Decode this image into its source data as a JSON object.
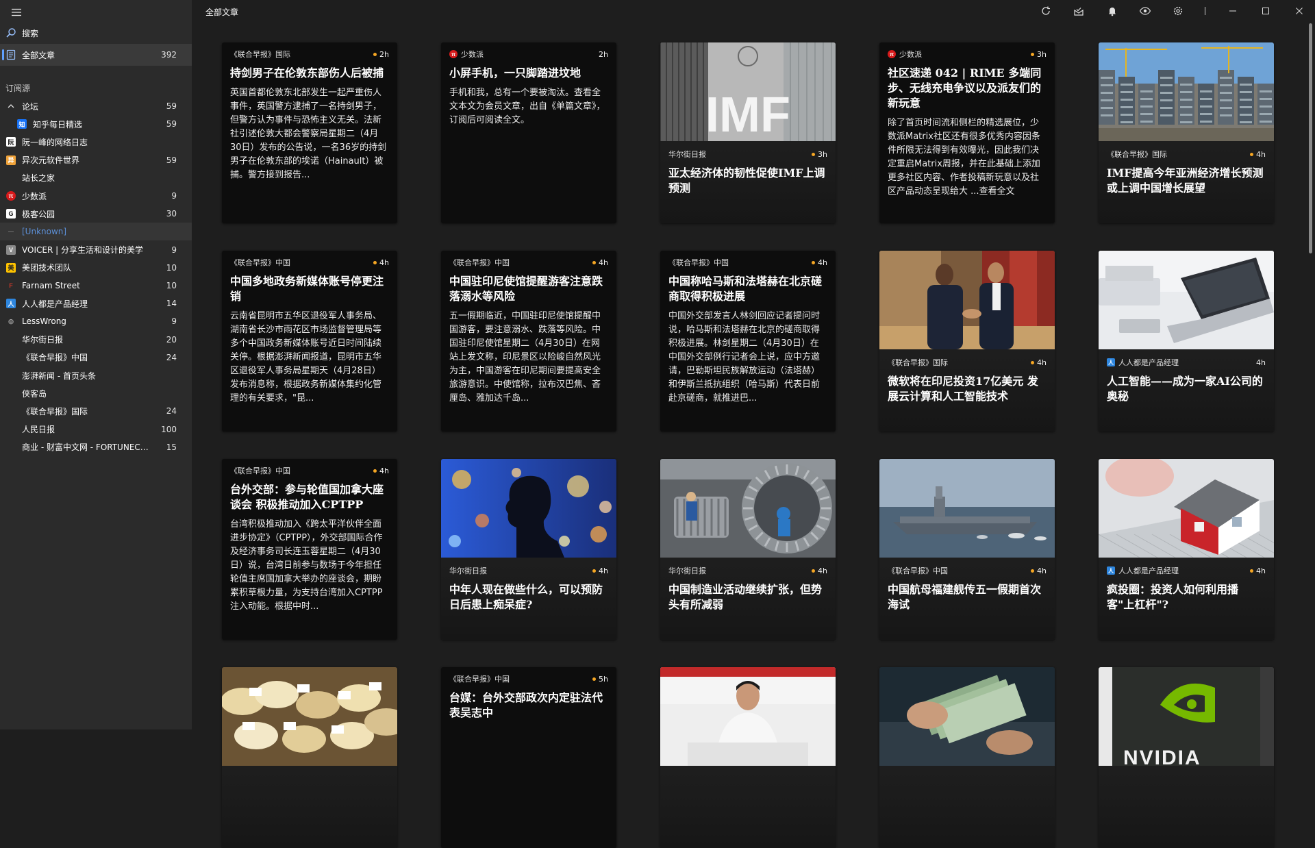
{
  "app": {
    "page_title": "全部文章"
  },
  "sidebar": {
    "search_label": "搜索",
    "all_articles": {
      "label": "全部文章",
      "count": "392"
    },
    "subscriptions_header": "订阅源",
    "items": [
      {
        "label": "论坛",
        "count": "59",
        "icon": "chevron-up-icon",
        "group": true
      },
      {
        "label": "知乎每日精选",
        "count": "59",
        "icon": "zhihu-icon",
        "indent": true
      },
      {
        "label": "阮一峰的网络日志",
        "count": "",
        "icon": "ruanyifeng-icon"
      },
      {
        "label": "异次元软件世界",
        "count": "59",
        "icon": "iplaysoft-icon"
      },
      {
        "label": "站长之家",
        "count": "",
        "icon": ""
      },
      {
        "label": "少数派",
        "count": "9",
        "icon": "sspai-icon"
      },
      {
        "label": "极客公园",
        "count": "30",
        "icon": "geekpark-icon"
      },
      {
        "label": "[Unknown]",
        "count": "",
        "icon": "unknown-icon",
        "unknown": true
      },
      {
        "label": "VOICER | 分享生活和设计的美学",
        "count": "9",
        "icon": "voicer-icon"
      },
      {
        "label": "美团技术团队",
        "count": "10",
        "icon": "meituan-icon"
      },
      {
        "label": "Farnam Street",
        "count": "10",
        "icon": "farnam-icon"
      },
      {
        "label": "人人都是产品经理",
        "count": "14",
        "icon": "woshipm-icon"
      },
      {
        "label": "LessWrong",
        "count": "9",
        "icon": "lesswrong-icon"
      },
      {
        "label": "华尔街日报",
        "count": "20",
        "icon": ""
      },
      {
        "label": "《联合早报》中国",
        "count": "24",
        "icon": ""
      },
      {
        "label": "澎湃新闻 - 首页头条",
        "count": "",
        "icon": ""
      },
      {
        "label": "侠客岛",
        "count": "",
        "icon": ""
      },
      {
        "label": "《联合早报》国际",
        "count": "24",
        "icon": ""
      },
      {
        "label": "人民日报",
        "count": "100",
        "icon": ""
      },
      {
        "label": "商业 - 财富中文网 - FORTUNEChina.c...",
        "count": "15",
        "icon": ""
      }
    ]
  },
  "titlebar": {
    "icons": [
      "refresh-icon",
      "mark-all-read-icon",
      "notification-icon",
      "view-mode-icon",
      "settings-icon"
    ],
    "window_controls": [
      "minimize-icon",
      "maximize-icon",
      "close-icon"
    ]
  },
  "articles": [
    {
      "source": "《联合早报》国际",
      "time": "2h",
      "unread": true,
      "image": "",
      "title": "持剑男子在伦敦东部伤人后被捕",
      "snippet": "英国首都伦敦东北部发生一起严重伤人事件，英国警方逮捕了一名持剑男子，但警方认为事件与恐怖主义无关。法新社引述伦敦大都会警察局星期二（4月30日）发布的公告说，一名36岁的持剑男子在伦敦东部的埃诺（Hainault）被捕。警方接到报告..."
    },
    {
      "source": "少数派",
      "time": "2h",
      "unread": false,
      "image": "",
      "favicon": "sspai",
      "title": "小屏手机，一只脚踏进坟地",
      "snippet": "手机和我，总有一个要被淘汰。查看全文本文为会员文章，出自《单篇文章》，订阅后可阅读全文。"
    },
    {
      "source": "华尔街日报",
      "time": "3h",
      "unread": true,
      "image": "imf",
      "title": "亚太经济体的韧性促使IMF上调预测",
      "snippet": ""
    },
    {
      "source": "少数派",
      "time": "3h",
      "unread": true,
      "image": "",
      "favicon": "sspai",
      "title": "社区速递 042 | RIME 多端同步、无线充电争议以及派友们的新玩意",
      "snippet": "除了首页时间流和侧栏的精选展位，少数派Matrix社区还有很多优秀内容因条件所限无法得到有效曝光，因此我们决定重启Matrix周报，并在此基础上添加更多社区内容、作者投稿新玩意以及社区产品动态呈现给大 ...查看全文"
    },
    {
      "source": "《联合早报》国际",
      "time": "4h",
      "unread": true,
      "image": "construction",
      "title": "IMF提高今年亚洲经济增长预测或上调中国增长展望",
      "snippet": ""
    },
    {
      "source": "《联合早报》中国",
      "time": "4h",
      "unread": true,
      "image": "",
      "title": "中国多地政务新媒体账号停更注销",
      "snippet": "云南省昆明市五华区退役军人事务局、湖南省长沙市雨花区市场监督管理局等多个中国政务新媒体账号近日时间陆续关停。根据澎湃新闻报道，昆明市五华区退役军人事务局星期天（4月28日）发布消息称，根据政务新媒体集约化管理的有关要求，\"昆..."
    },
    {
      "source": "《联合早报》中国",
      "time": "4h",
      "unread": true,
      "image": "",
      "title": "中国驻印尼使馆提醒游客注意跌落溺水等风险",
      "snippet": "五一假期临近，中国驻印尼使馆提醒中国游客，要注意溺水、跌落等风险。中国驻印尼使馆星期二（4月30日）在网站上发文称，印尼景区以险峻自然风光为主，中国游客在印尼期间要提高安全旅游意识。中使馆称，拉布汉巴焦、吝厘岛、雅加达千岛..."
    },
    {
      "source": "《联合早报》中国",
      "time": "4h",
      "unread": true,
      "image": "",
      "title": "中国称哈马斯和法塔赫在北京磋商取得积极进展",
      "snippet": "中国外交部发言人林剑回应记者提问时说，哈马斯和法塔赫在北京的磋商取得积极进展。林剑星期二（4月30日）在中国外交部例行记者会上说，应中方邀请，巴勒斯坦民族解放运动（法塔赫）和伊斯兰抵抗组织（哈马斯）代表日前赴京磋商，就推进巴..."
    },
    {
      "source": "《联合早报》国际",
      "time": "4h",
      "unread": true,
      "image": "handshake",
      "title": "微软将在印尼投资17亿美元 发展云计算和人工智能技术",
      "snippet": ""
    },
    {
      "source": "人人都是产品经理",
      "time": "4h",
      "unread": false,
      "image": "laptop",
      "favicon": "woshipm",
      "title": "人工智能——成为一家AI公司的奥秘",
      "snippet": ""
    },
    {
      "source": "《联合早报》中国",
      "time": "4h",
      "unread": true,
      "image": "",
      "title": "台外交部：参与轮值国加拿大座谈会 积极推动加入CPTPP",
      "snippet": "台湾积极推动加入《跨太平洋伙伴全面进步协定》（CPTPP），外交部国际合作及经济事务司长连玉蓉星期二（4月30日）说，台湾日前参与数场于今年担任轮值主席国加拿大举办的座谈会，期盼累积草根力量，为支持台湾加入CPTPP注入动能。根据中时..."
    },
    {
      "source": "华尔街日报",
      "time": "4h",
      "unread": true,
      "image": "silhouette",
      "title": "中年人现在做些什么，可以预防日后患上痴呆症?",
      "snippet": ""
    },
    {
      "source": "华尔街日报",
      "time": "4h",
      "unread": true,
      "image": "factory",
      "title": "中国制造业活动继续扩张，但势头有所减弱",
      "snippet": ""
    },
    {
      "source": "《联合早报》中国",
      "time": "4h",
      "unread": true,
      "image": "carrier",
      "title": "中国航母福建舰传五一假期首次海试",
      "snippet": ""
    },
    {
      "source": "人人都是产品经理",
      "time": "4h",
      "unread": true,
      "image": "house",
      "favicon": "woshipm",
      "title": "疯投圈：投资人如何利用播客\"上杠杆\"?",
      "snippet": ""
    },
    {
      "source": "",
      "time": "",
      "unread": false,
      "image": "cheese",
      "title": "",
      "snippet": ""
    },
    {
      "source": "《联合早报》中国",
      "time": "5h",
      "unread": true,
      "image": "",
      "title": "台媒：台外交部政次内定驻法代表吴志中",
      "snippet": ""
    },
    {
      "source": "",
      "time": "",
      "unread": false,
      "image": "official",
      "title": "",
      "snippet": ""
    },
    {
      "source": "",
      "time": "",
      "unread": false,
      "image": "money",
      "title": "",
      "snippet": ""
    },
    {
      "source": "",
      "time": "",
      "unread": false,
      "image": "nvidia",
      "title": "",
      "image_text": "NVIDIA",
      "snippet": ""
    }
  ],
  "colors": {
    "unread_dot": "#f5a623",
    "accent": "#5fa0ff",
    "sidebar_bg": "#2b2b2b",
    "main_bg": "#1e1e1e"
  }
}
